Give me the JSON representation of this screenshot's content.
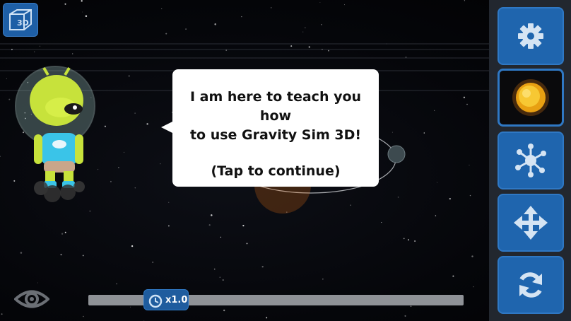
{
  "view_toggle": {
    "label": "3D",
    "icon": "cube-3d-icon"
  },
  "tutorial": {
    "line1": "I am here to teach you how",
    "line2": "to use Gravity Sim 3D!",
    "continue_text": "(Tap to continue)"
  },
  "sidebar": {
    "buttons": [
      {
        "name": "settings",
        "icon": "gear-icon"
      },
      {
        "name": "add-body",
        "icon": "sun-icon",
        "selected": true
      },
      {
        "name": "edit-orbit",
        "icon": "network-icon"
      },
      {
        "name": "move",
        "icon": "move-arrows-icon"
      },
      {
        "name": "reset",
        "icon": "refresh-icon"
      }
    ]
  },
  "bottom": {
    "eye_icon": "eye-icon",
    "speed_label": "x1.0",
    "speed_icon": "clock-icon"
  },
  "colors": {
    "accent": "#1f65ae",
    "sidebar_bg": "#22272f",
    "sun": "#f2b21c"
  }
}
